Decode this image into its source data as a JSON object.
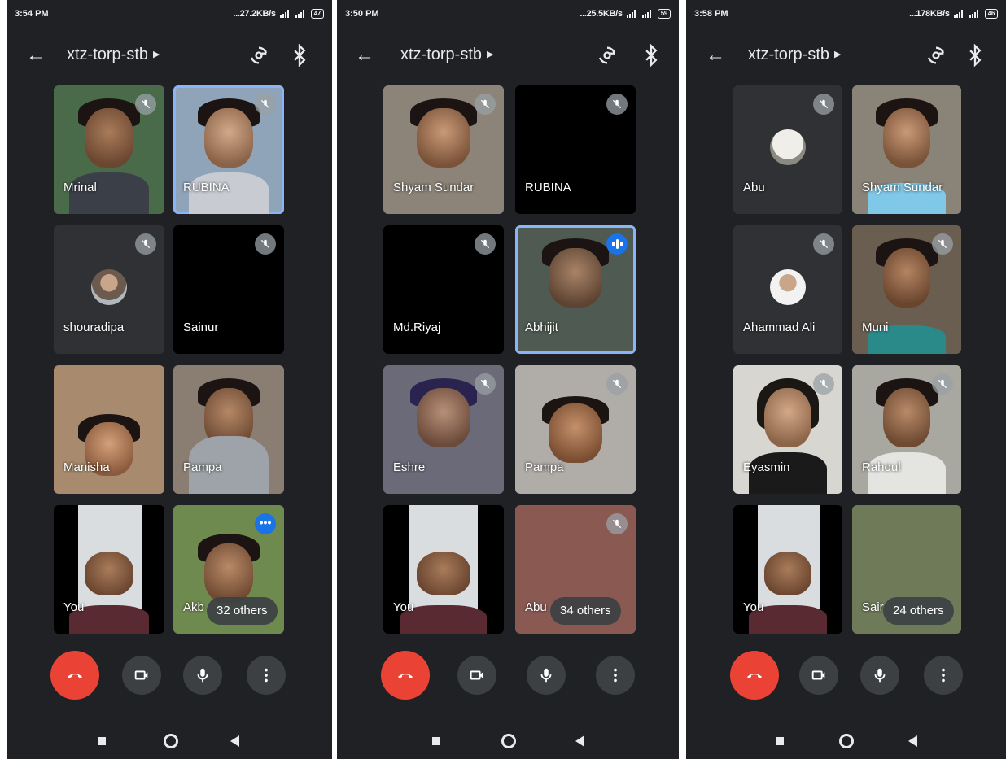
{
  "screens": [
    {
      "status": {
        "time": "3:54 PM",
        "speed": "...27.2KB/s",
        "battery": "47"
      },
      "meeting_title": "xtz-torp-stb",
      "tiles": [
        {
          "name": "Mrinal"
        },
        {
          "name": "RUBINA"
        },
        {
          "name": "shouradipa"
        },
        {
          "name": "Sainur"
        },
        {
          "name": "Manisha"
        },
        {
          "name": "Pampa"
        },
        {
          "name": "You"
        },
        {
          "name": "Akb"
        }
      ],
      "others": "32 others"
    },
    {
      "status": {
        "time": "3:50 PM",
        "speed": "...25.5KB/s",
        "battery": "59"
      },
      "meeting_title": "xtz-torp-stb",
      "tiles": [
        {
          "name": "Shyam Sundar"
        },
        {
          "name": "RUBINA"
        },
        {
          "name": "Md.Riyaj"
        },
        {
          "name": "Abhijit"
        },
        {
          "name": "Eshre"
        },
        {
          "name": "Pampa"
        },
        {
          "name": "You"
        },
        {
          "name": "Abu"
        }
      ],
      "others": "34 others"
    },
    {
      "status": {
        "time": "3:58 PM",
        "speed": "...178KB/s",
        "battery": "46"
      },
      "meeting_title": "xtz-torp-stb",
      "tiles": [
        {
          "name": "Abu"
        },
        {
          "name": "Shyam Sundar"
        },
        {
          "name": "Ahammad Ali"
        },
        {
          "name": "Muni"
        },
        {
          "name": "Eyasmin"
        },
        {
          "name": "Rahoul"
        },
        {
          "name": "You"
        },
        {
          "name": "Sair"
        }
      ],
      "others": "24 others"
    }
  ],
  "colors": {
    "end_call": "#ea4335",
    "speaking": "#8ab4f8",
    "accent": "#1a73e8",
    "background": "#202124"
  },
  "icons": [
    "back-arrow-icon",
    "caret-right-icon",
    "switch-camera-icon",
    "bluetooth-icon",
    "mic-off-icon",
    "audio-level-icon",
    "more-dots-icon",
    "end-call-icon",
    "video-icon",
    "mic-icon",
    "more-vert-icon",
    "nav-square-icon",
    "nav-home-icon",
    "nav-back-icon"
  ]
}
